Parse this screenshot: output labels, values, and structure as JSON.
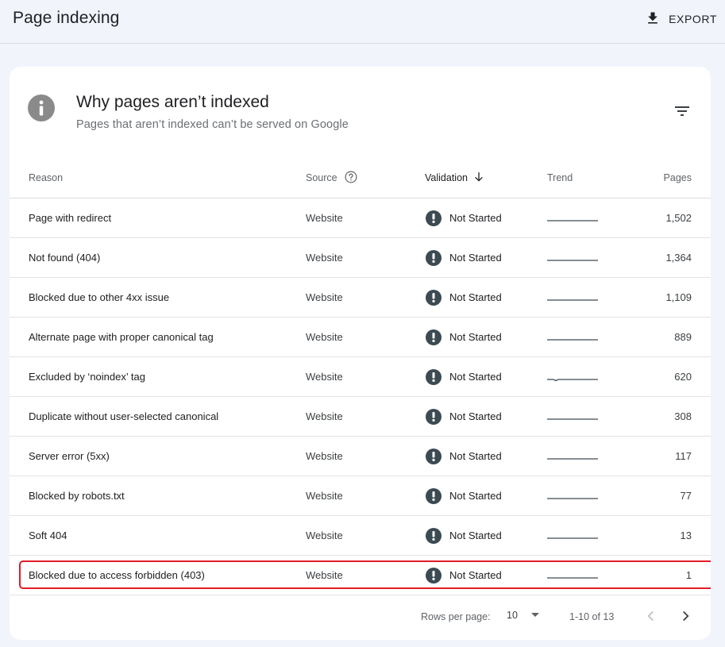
{
  "header": {
    "title": "Page indexing",
    "export_label": "EXPORT"
  },
  "card": {
    "title": "Why pages aren’t indexed",
    "subtitle": "Pages that aren’t indexed can’t be served on Google"
  },
  "table": {
    "columns": {
      "reason": "Reason",
      "source": "Source",
      "validation": "Validation",
      "trend": "Trend",
      "pages": "Pages"
    },
    "rows": [
      {
        "reason": "Page with redirect",
        "source": "Website",
        "validation": "Not Started",
        "pages": "1,502"
      },
      {
        "reason": "Not found (404)",
        "source": "Website",
        "validation": "Not Started",
        "pages": "1,364"
      },
      {
        "reason": "Blocked due to other 4xx issue",
        "source": "Website",
        "validation": "Not Started",
        "pages": "1,109"
      },
      {
        "reason": "Alternate page with proper canonical tag",
        "source": "Website",
        "validation": "Not Started",
        "pages": "889"
      },
      {
        "reason": "Excluded by ‘noindex’ tag",
        "source": "Website",
        "validation": "Not Started",
        "pages": "620"
      },
      {
        "reason": "Duplicate without user-selected canonical",
        "source": "Website",
        "validation": "Not Started",
        "pages": "308"
      },
      {
        "reason": "Server error (5xx)",
        "source": "Website",
        "validation": "Not Started",
        "pages": "117"
      },
      {
        "reason": "Blocked by robots.txt",
        "source": "Website",
        "validation": "Not Started",
        "pages": "77"
      },
      {
        "reason": "Soft 404",
        "source": "Website",
        "validation": "Not Started",
        "pages": "13"
      },
      {
        "reason": "Blocked due to access forbidden (403)",
        "source": "Website",
        "validation": "Not Started",
        "pages": "1"
      }
    ]
  },
  "pagination": {
    "rows_per_page_label": "Rows per page:",
    "rows_per_page_value": "10",
    "range": "1-10 of 13"
  },
  "colors": {
    "highlight": "#e21b25",
    "validation_icon": "#3c4a52",
    "info_icon": "#8a8a8a"
  },
  "icons": {
    "export": "download-icon",
    "info": "info-icon",
    "filter": "filter-icon",
    "help": "help-circle-icon",
    "sort": "arrow-down-icon",
    "validation": "exclamation-circle-icon"
  }
}
